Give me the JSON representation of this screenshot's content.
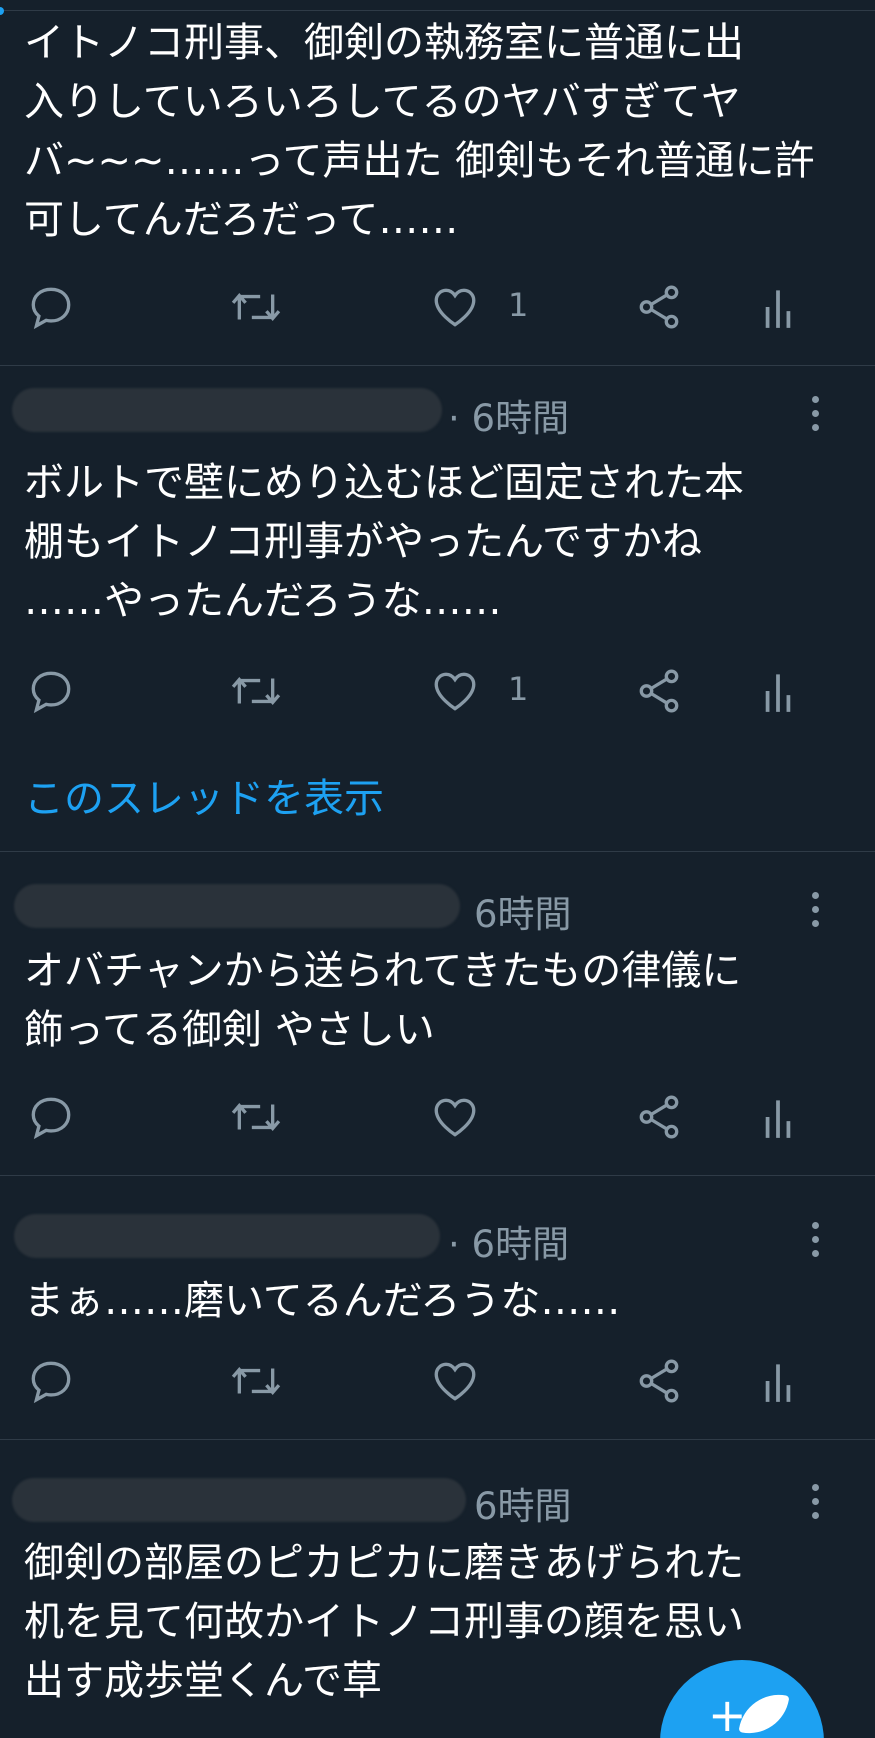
{
  "colors": {
    "background": "#15202b",
    "accent": "#1da1f2",
    "muted": "#8899a6",
    "divider": "#2f3b47"
  },
  "tweets": [
    {
      "time": "",
      "text": "イトノコ刑事、御剣の執務室に普通に出\n入りしていろいろしてるのヤバすぎてヤ\nバ~~~……って声出た 御剣もそれ普通に許\n可してんだろだって……",
      "reply_count": "",
      "retweet_count": "",
      "like_count": "1"
    },
    {
      "time": "· 6時間",
      "text": "ボルトで壁にめり込むほど固定された本\n棚もイトノコ刑事がやったんですかね\n……やったんだろうな……",
      "reply_count": "",
      "retweet_count": "",
      "like_count": "1",
      "thread_link": "このスレッドを表示"
    },
    {
      "time": "6時間",
      "text": "オバチャンから送られてきたもの律儀に\n飾ってる御剣 やさしい",
      "reply_count": "",
      "retweet_count": "",
      "like_count": ""
    },
    {
      "time": "· 6時間",
      "text": "まぁ……磨いてるんだろうな……",
      "reply_count": "",
      "retweet_count": "",
      "like_count": ""
    },
    {
      "time": "6時間",
      "text": "御剣の部屋のピカピカに磨きあげられた\n机を見て何故かイトノコ刑事の顔を思い\n出す成歩堂くんで草"
    }
  ],
  "icons": {
    "reply": "reply-icon",
    "retweet": "retweet-icon",
    "like": "heart-icon",
    "share": "share-icon",
    "analytics": "analytics-icon",
    "more": "more-vertical-icon",
    "compose": "compose-tweet-icon"
  }
}
